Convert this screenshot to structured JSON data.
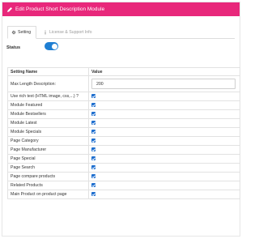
{
  "header": {
    "title": "Edit Product Short Description Module",
    "icon": "pencil-icon",
    "color": "#e8287b"
  },
  "tabs": [
    {
      "label": "Setting",
      "icon": "gear-icon",
      "active": true
    },
    {
      "label": "License & Support Info",
      "icon": "info-icon",
      "active": false
    }
  ],
  "status": {
    "label": "Status",
    "enabled": true,
    "accent": "#1f7fd3"
  },
  "table": {
    "headers": [
      "Setting Name",
      "Value"
    ],
    "max_length": {
      "label": "Max Length Description:",
      "value": "200"
    },
    "rows": [
      {
        "label": "Use rich text (HTML image, css,...) ?",
        "checked": true
      },
      {
        "label": "Module Featured",
        "checked": true
      },
      {
        "label": "Module Bestsellers",
        "checked": true
      },
      {
        "label": "Module Latest",
        "checked": true
      },
      {
        "label": "Module Specials",
        "checked": true
      },
      {
        "label": "Page Category",
        "checked": true
      },
      {
        "label": "Page Manufacturer",
        "checked": true
      },
      {
        "label": "Page Special",
        "checked": true
      },
      {
        "label": "Page Search",
        "checked": true
      },
      {
        "label": "Page compare products",
        "checked": true
      },
      {
        "label": "Related Products",
        "checked": true
      },
      {
        "label": "Main Product on product page",
        "checked": true
      }
    ]
  }
}
